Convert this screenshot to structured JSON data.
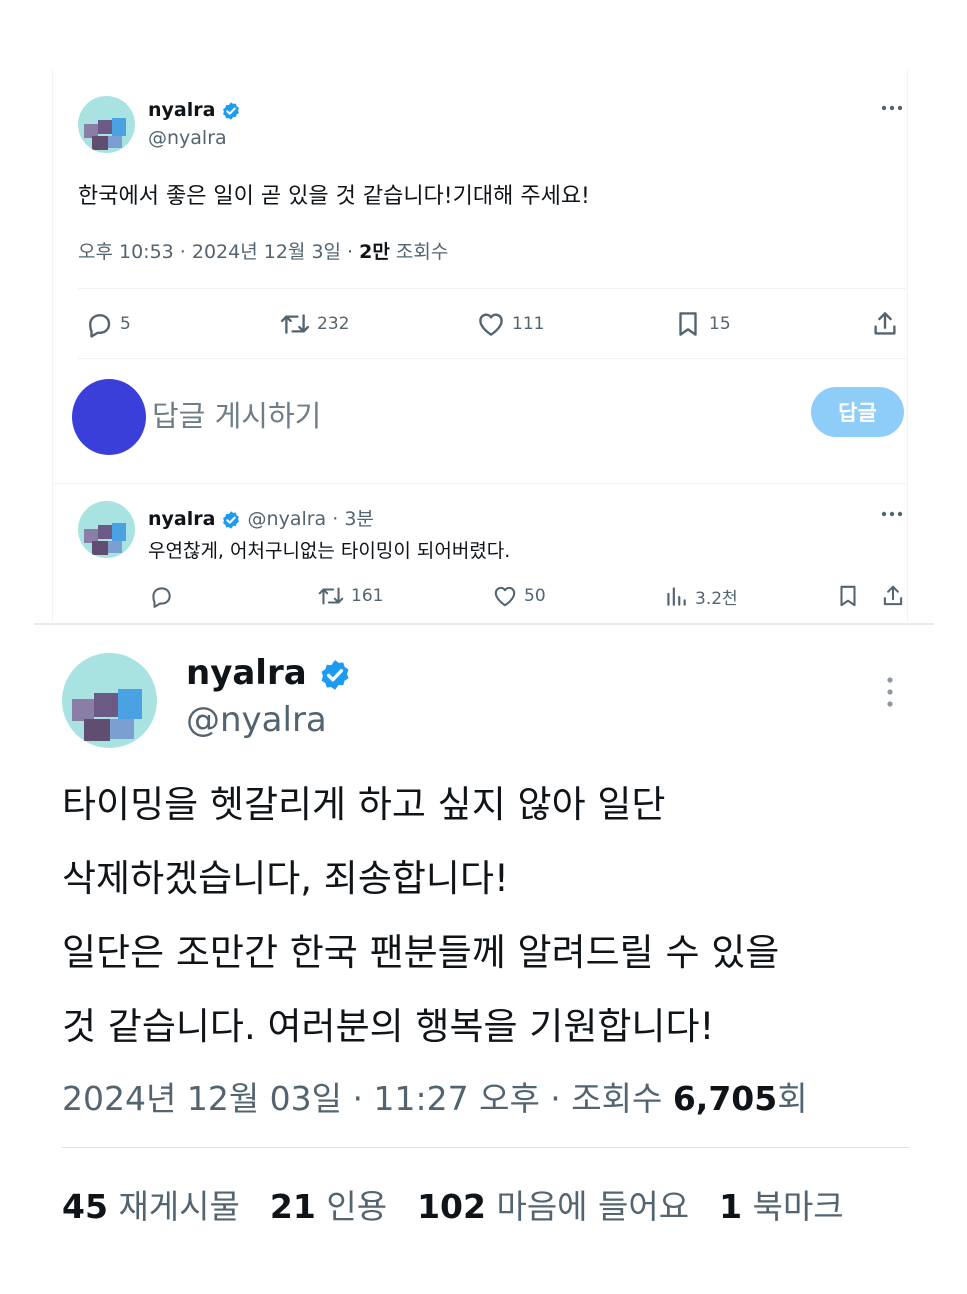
{
  "colors": {
    "accent": "#1d9bf0",
    "reply_button_bg": "#8ecdf8",
    "composer_avatar": "#3a3fd9",
    "muted_text": "#536471",
    "avatar_bg": "#a9e3e1"
  },
  "top_card": {
    "tweet": {
      "display_name": "nyalra",
      "handle": "@nyalra",
      "text": "한국에서 좋은 일이 곧 있을 것 같습니다!기대해 주세요!",
      "meta_time": "오후 10:53 · 2024년 12월 3일 · ",
      "meta_views_count": "2만",
      "meta_views_label": " 조회수",
      "more_icon": "more-horizontal-icon",
      "actions": {
        "replies": "5",
        "retweets": "232",
        "likes": "111",
        "bookmarks": "15"
      }
    },
    "composer": {
      "placeholder": "답글 게시하기",
      "reply_button": "답글"
    },
    "reply": {
      "display_name": "nyalra",
      "handle_time": "@nyalra · 3분",
      "text": "우연찮게, 어처구니없는 타이밍이 되어버렸다.",
      "actions": {
        "retweets": "161",
        "likes": "50",
        "views": "3.2천"
      }
    }
  },
  "bottom_card": {
    "display_name": "nyalra",
    "handle": "@nyalra",
    "text_lines": [
      "타이밍을 헷갈리게 하고 싶지 않아 일단",
      "삭제하겠습니다, 죄송합니다!",
      "일단은 조만간 한국 팬분들께 알려드릴 수 있을",
      "것 같습니다. 여러분의 행복을 기원합니다!"
    ],
    "meta_text": "2024년 12월 03일 · 11:27 오후 · 조회수 ",
    "meta_views": "6,705",
    "meta_views_suffix": "회",
    "stats": [
      {
        "count": "45",
        "label": "재게시물"
      },
      {
        "count": "21",
        "label": "인용"
      },
      {
        "count": "102",
        "label": "마음에 들어요"
      },
      {
        "count": "1",
        "label": "북마크"
      }
    ]
  }
}
